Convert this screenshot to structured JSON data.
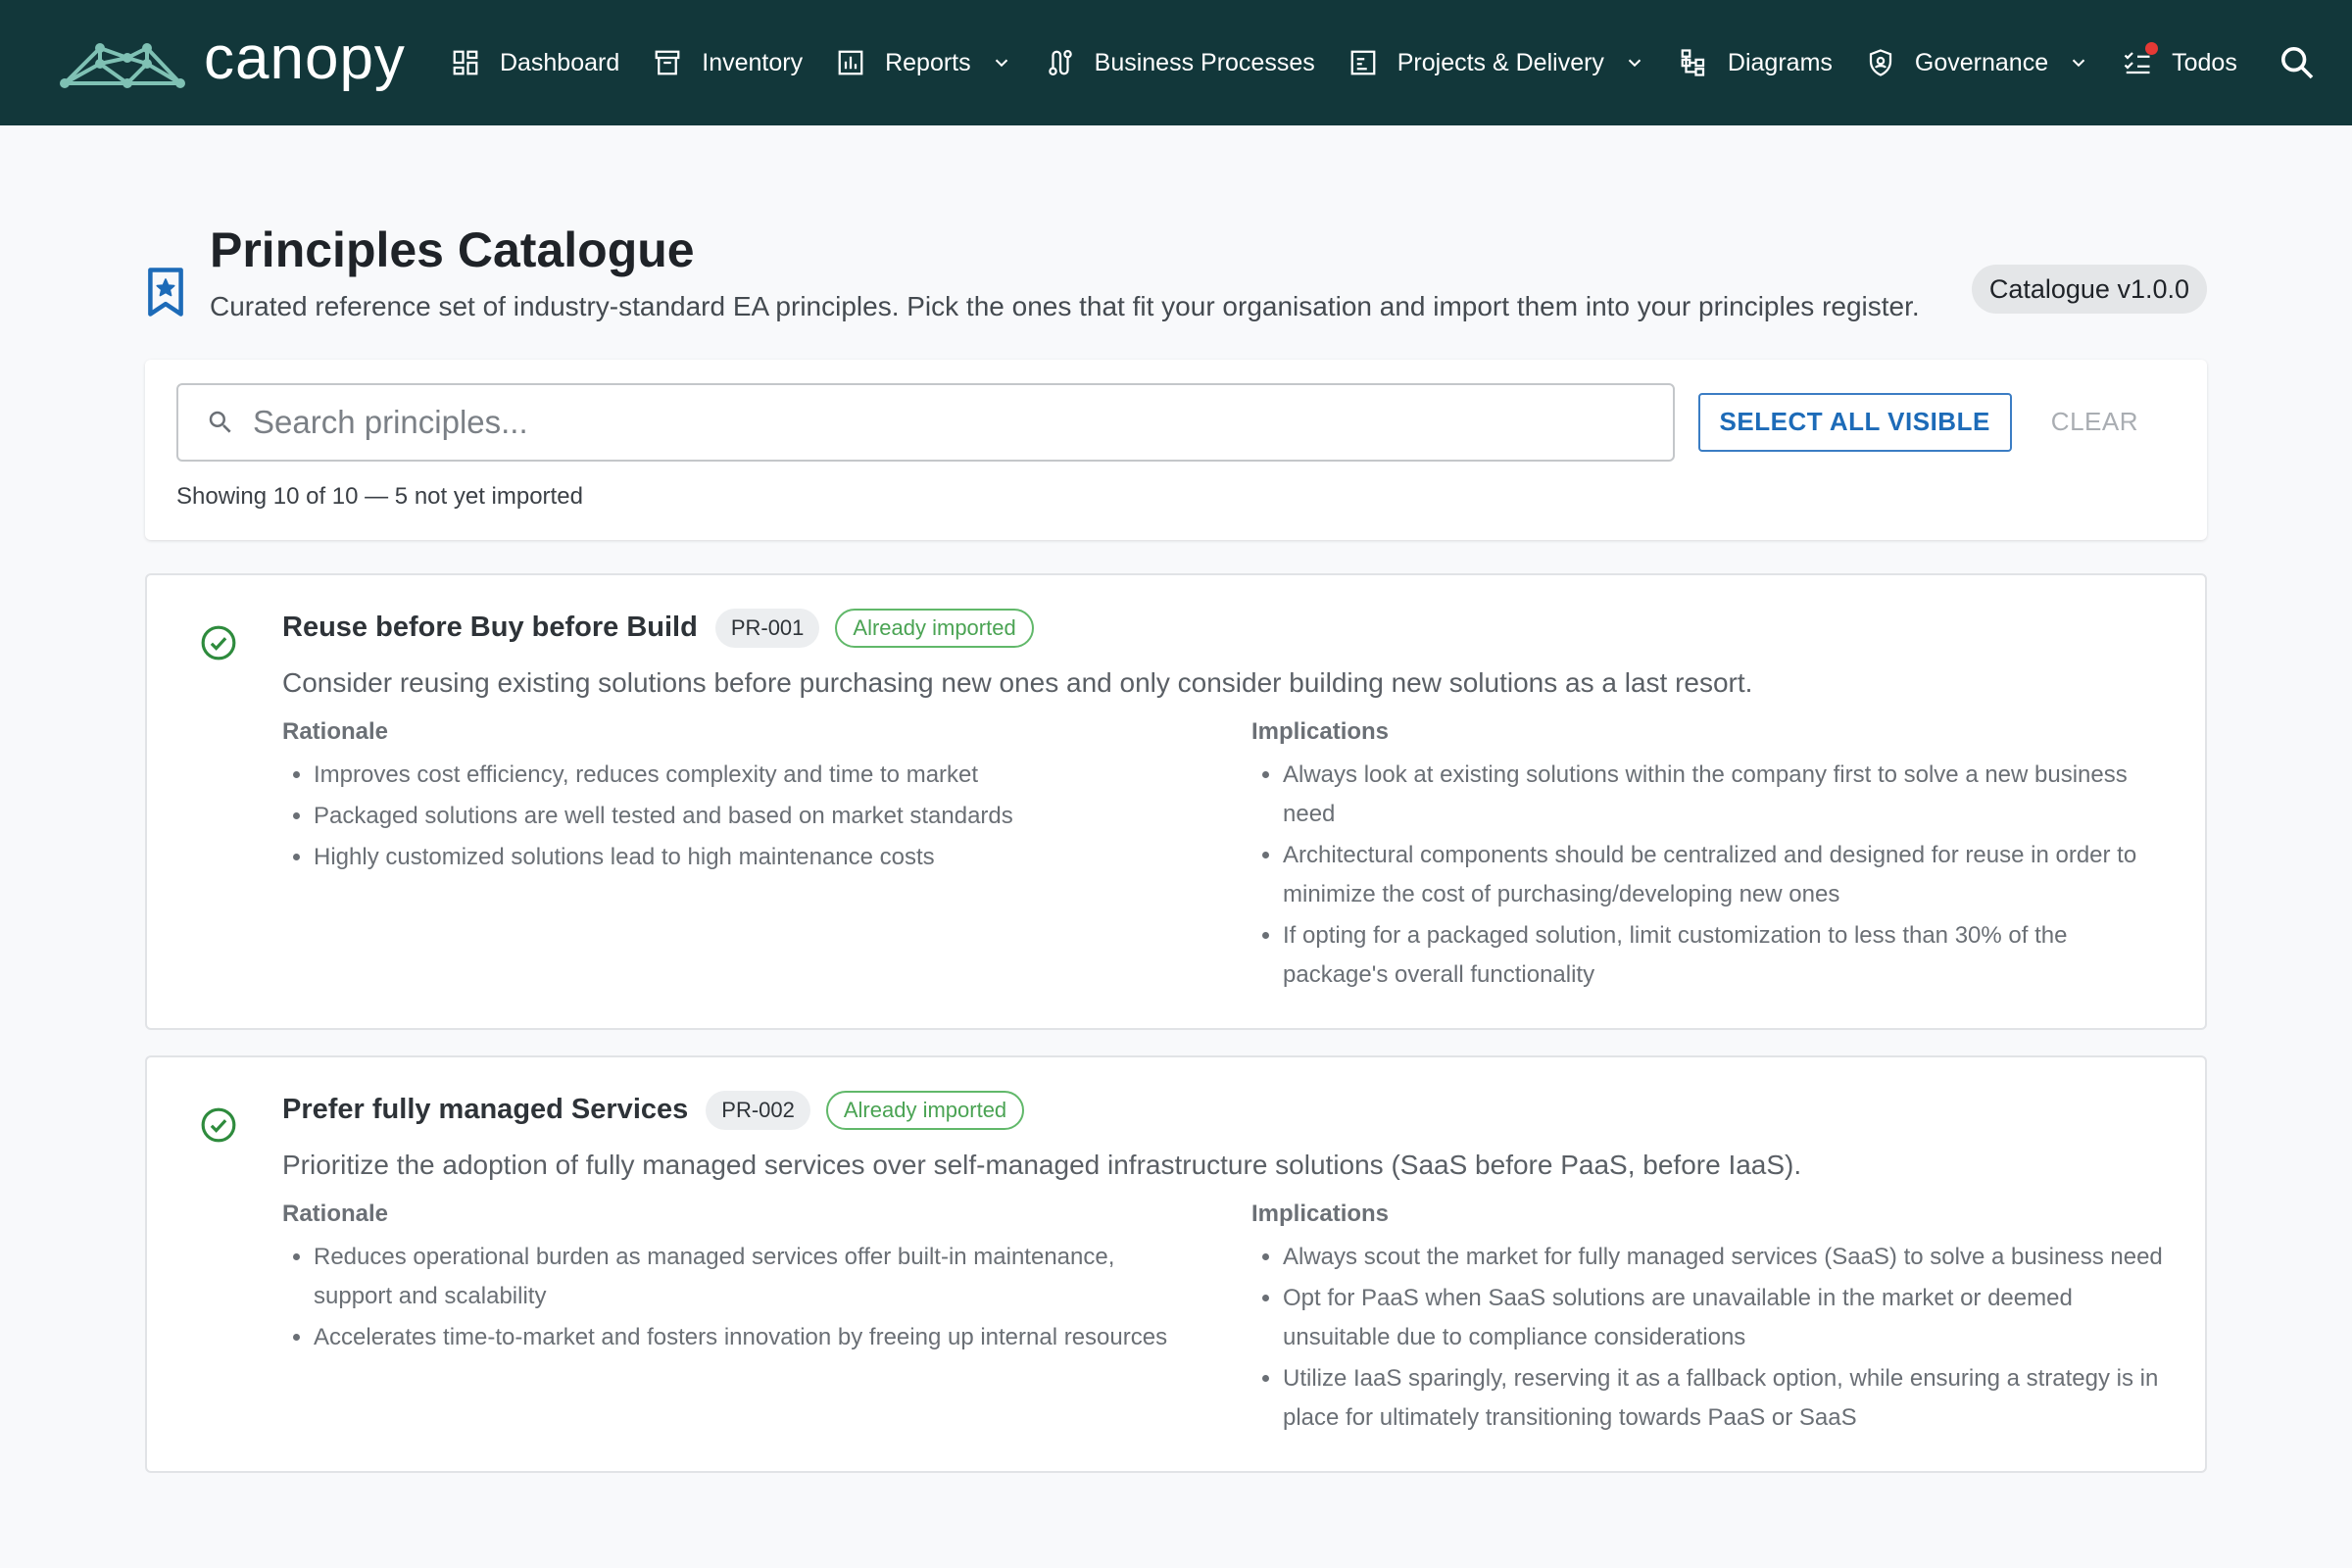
{
  "app": {
    "brand": "canopy",
    "colors": {
      "nav_bg": "#12373a",
      "accent": "#1d6bb8",
      "success": "#4aa353",
      "notification": "#e53935"
    }
  },
  "nav": {
    "items": [
      {
        "label": "Dashboard",
        "icon": "dashboard-icon"
      },
      {
        "label": "Inventory",
        "icon": "archive-icon"
      },
      {
        "label": "Reports",
        "icon": "bar-chart-icon",
        "dropdown": true
      },
      {
        "label": "Business Processes",
        "icon": "route-icon"
      },
      {
        "label": "Projects & Delivery",
        "icon": "project-icon",
        "dropdown": true
      },
      {
        "label": "Diagrams",
        "icon": "tree-diagram-icon"
      },
      {
        "label": "Governance",
        "icon": "shield-icon",
        "dropdown": true
      },
      {
        "label": "Todos",
        "icon": "checklist-icon",
        "notification": true
      }
    ],
    "search_icon": "search-icon"
  },
  "page": {
    "title": "Principles Catalogue",
    "subtitle": "Curated reference set of industry-standard EA principles. Pick the ones that fit your organisation and import them into your principles register.",
    "version": "Catalogue v1.0.0",
    "icon": "bookmark-star-icon"
  },
  "toolbar": {
    "search_placeholder": "Search principles...",
    "search_value": "",
    "select_all_label": "SELECT ALL VISIBLE",
    "clear_label": "CLEAR",
    "count_text": "Showing 10 of 10 — 5 not yet imported"
  },
  "principles": [
    {
      "title": "Reuse before Buy before Build",
      "code": "PR-001",
      "status": "Already imported",
      "description": "Consider reusing existing solutions before purchasing new ones and only consider building new solutions as a last resort.",
      "rationale_title": "Rationale",
      "rationale": [
        "Improves cost efficiency, reduces complexity and time to market",
        "Packaged solutions are well tested and based on market standards",
        "Highly customized solutions lead to high maintenance costs"
      ],
      "implications_title": "Implications",
      "implications": [
        "Always look at existing solutions within the company first to solve a new business need",
        "Architectural components should be centralized and designed for reuse in order to minimize the cost of purchasing/developing new ones",
        "If opting for a packaged solution, limit customization to less than 30% of the package's overall functionality"
      ]
    },
    {
      "title": "Prefer fully managed Services",
      "code": "PR-002",
      "status": "Already imported",
      "description": "Prioritize the adoption of fully managed services over self-managed infrastructure solutions (SaaS before PaaS, before IaaS).",
      "rationale_title": "Rationale",
      "rationale": [
        "Reduces operational burden as managed services offer built-in maintenance, support and scalability",
        "Accelerates time-to-market and fosters innovation by freeing up internal resources"
      ],
      "implications_title": "Implications",
      "implications": [
        "Always scout the market for fully managed services (SaaS) to solve a business need",
        "Opt for PaaS when SaaS solutions are unavailable in the market or deemed unsuitable due to compliance considerations",
        "Utilize IaaS sparingly, reserving it as a fallback option, while ensuring a strategy is in place for ultimately transitioning towards PaaS or SaaS"
      ]
    }
  ]
}
